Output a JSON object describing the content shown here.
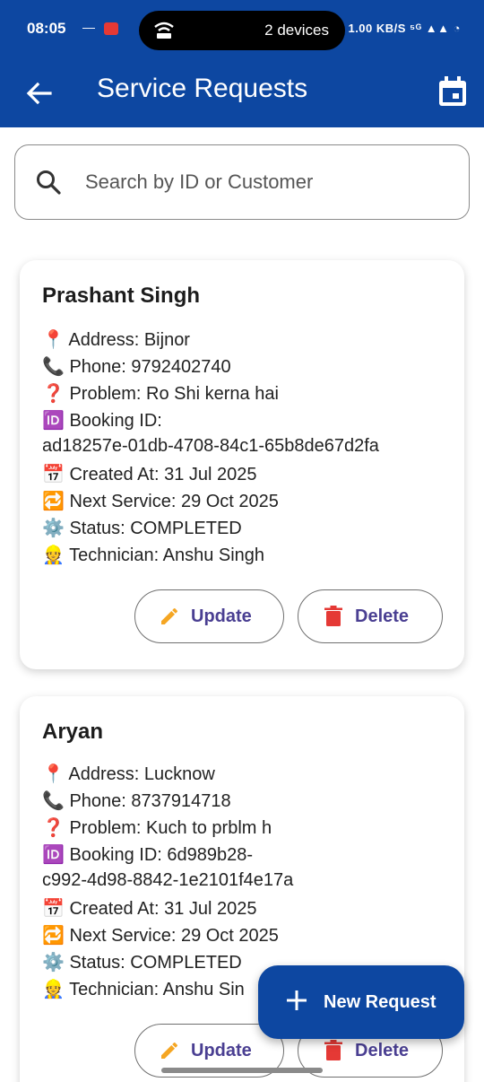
{
  "status_bar": {
    "time": "08:05",
    "dash": "—",
    "devices_label": "2 devices",
    "network_info": "1.00 KB/S ⁵ᴳ ▲▲ ◔"
  },
  "app_bar": {
    "title": "Service Requests"
  },
  "search": {
    "placeholder": "Search by ID or Customer"
  },
  "labels": {
    "address": "Address:",
    "phone": "Phone:",
    "problem": "Problem:",
    "booking_id": "Booking ID:",
    "created_at": "Created At:",
    "next_service": "Next Service:",
    "status": "Status:",
    "technician": "Technician:"
  },
  "requests": [
    {
      "name": "Prashant Singh",
      "address": "📍 Address: Bijnor",
      "phone": "📞 Phone: 9792402740",
      "problem": "❓ Problem: Ro Shi kerna hai",
      "booking_line1": "🆔 Booking ID:",
      "booking_line2": "ad18257e-01db-4708-84c1-65b8de67d2fa",
      "created": "📅 Created At: 31 Jul 2025",
      "next_service": "🔁 Next Service: 29 Oct 2025",
      "status": "⚙️ Status: COMPLETED",
      "technician": "👷 Technician: Anshu Singh",
      "update_label": "Update",
      "delete_label": "Delete"
    },
    {
      "name": "Aryan",
      "address": "📍 Address: Lucknow",
      "phone": "📞 Phone: 8737914718",
      "problem": "❓ Problem: Kuch to prblm h",
      "booking_line1": "🆔 Booking ID: 6d989b28-",
      "booking_line2": "c992-4d98-8842-1e2101f4e17a",
      "created": "📅 Created At: 31 Jul 2025",
      "next_service": "🔁 Next Service: 29 Oct 2025",
      "status": "⚙️ Status: COMPLETED",
      "technician": "👷 Technician: Anshu Sin",
      "update_label": "Update",
      "delete_label": "Delete"
    }
  ],
  "fab": {
    "label": "New Request"
  },
  "colors": {
    "primary": "#0d47a1",
    "button_text": "#4a3f92",
    "edit_icon": "#f5a623",
    "delete_icon": "#e53935"
  },
  "icons": {
    "back": "back-arrow-icon",
    "calendar": "calendar-icon",
    "search": "search-icon",
    "edit": "pencil-icon",
    "delete": "trash-icon",
    "add": "plus-icon"
  }
}
